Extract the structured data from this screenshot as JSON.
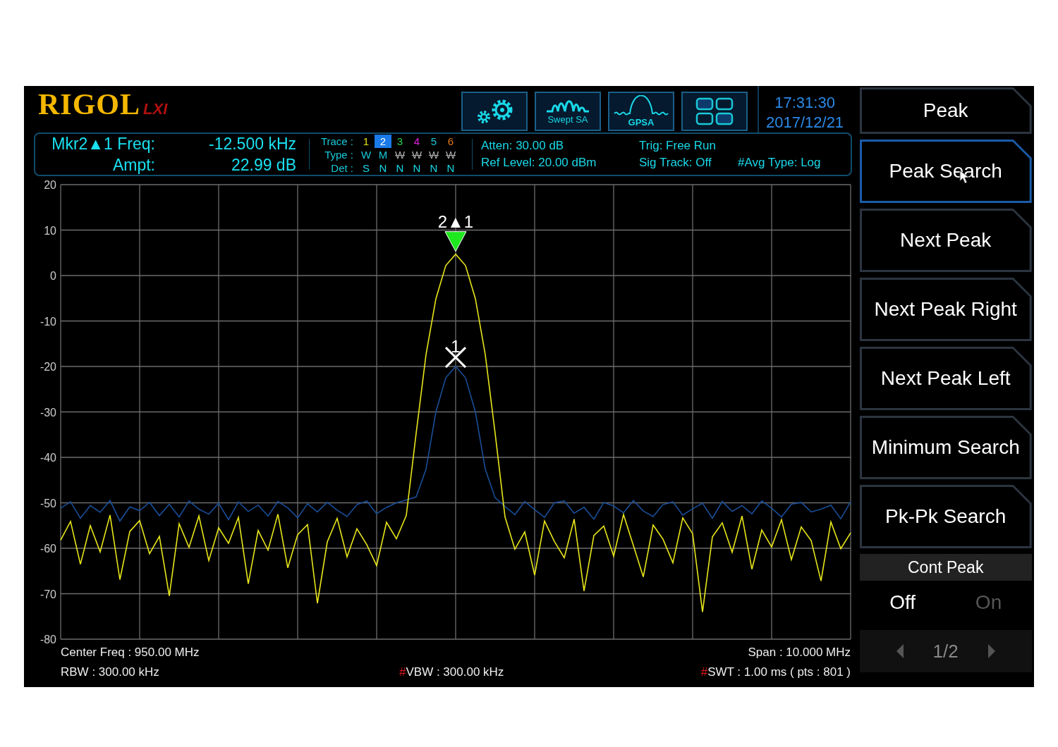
{
  "logo": {
    "brand": "RIGOL",
    "badge": "LXI"
  },
  "mode_buttons": [
    {
      "kind": "settings"
    },
    {
      "kind": "swept",
      "label": "Swept SA"
    },
    {
      "kind": "gpsa",
      "label": "GPSA"
    },
    {
      "kind": "layout"
    }
  ],
  "clock": {
    "time": "17:31:30",
    "date": "2017/12/21"
  },
  "marker_readout": [
    {
      "label": "Mkr2▲1 Freq:",
      "value": "-12.500 kHz"
    },
    {
      "label": "Ampt:",
      "value": "22.99 dB"
    }
  ],
  "trace_table": {
    "trace_label": "Trace :",
    "type_label": "Type :",
    "det_label": "Det :",
    "traces": [
      {
        "number": "1",
        "color": "#e6e01a",
        "selected": false,
        "type": "W",
        "type_blank": false,
        "det": "S"
      },
      {
        "number": "2",
        "color": "#1a7ae8",
        "selected": true,
        "type": "M",
        "type_blank": false,
        "det": "N"
      },
      {
        "number": "3",
        "color": "#2fd04a",
        "selected": false,
        "type": "W",
        "type_blank": true,
        "det": "N"
      },
      {
        "number": "4",
        "color": "#e020e0",
        "selected": false,
        "type": "W",
        "type_blank": true,
        "det": "N"
      },
      {
        "number": "5",
        "color": "#19c8d8",
        "selected": false,
        "type": "W",
        "type_blank": true,
        "det": "N"
      },
      {
        "number": "6",
        "color": "#e07a1a",
        "selected": false,
        "type": "W",
        "type_blank": true,
        "det": "N"
      }
    ]
  },
  "status": [
    [
      "Atten: 30.00 dB",
      "Trig: Free Run"
    ],
    [
      "Ref Level: 20.00 dBm",
      "Sig Track: Off",
      "#Avg Type: Log"
    ]
  ],
  "chart_data": {
    "type": "line",
    "grid": true,
    "ylim": [
      -80,
      20
    ],
    "yticks": [
      20,
      10,
      0,
      -10,
      -20,
      -30,
      -40,
      -50,
      -60,
      -70,
      -80
    ],
    "series": [
      {
        "color": "#1a4e98",
        "values": [
          -51.2,
          -49.8,
          -53.4,
          -50.6,
          -52.1,
          -49.5,
          -54.0,
          -50.9,
          -51.7,
          -49.9,
          -52.8,
          -50.3,
          -53.1,
          -49.6,
          -51.4,
          -52.5,
          -50.1,
          -53.7,
          -49.8,
          -51.9,
          -50.5,
          -52.9,
          -49.7,
          -51.1,
          -53.3,
          -50.2,
          -52.0,
          -49.9,
          -51.6,
          -53.0,
          -50.4,
          -49.6,
          -52.4,
          -51.0,
          -50.0,
          -49.4,
          -48.7,
          -42.6,
          -30.0,
          -22.5,
          -20.0,
          -22.5,
          -30.0,
          -42.6,
          -48.9,
          -50.8,
          -52.6,
          -49.7,
          -51.5,
          -53.2,
          -50.0,
          -49.6,
          -52.3,
          -51.0,
          -53.6,
          -49.9,
          -50.7,
          -52.2,
          -49.5,
          -51.8,
          -53.0,
          -50.4,
          -49.8,
          -52.7,
          -51.3,
          -50.1,
          -53.4,
          -49.7,
          -51.9,
          -50.6,
          -52.4,
          -49.6,
          -51.2,
          -53.1,
          -50.3,
          -49.9,
          -52.0,
          -51.4,
          -50.5,
          -53.5,
          -49.8
        ]
      },
      {
        "color": "#e8e61a",
        "values": [
          -58.2,
          -54.1,
          -63.5,
          -55.0,
          -60.8,
          -52.7,
          -66.9,
          -56.3,
          -53.9,
          -61.2,
          -57.4,
          -70.5,
          -54.6,
          -59.8,
          -52.9,
          -62.7,
          -55.5,
          -58.9,
          -53.2,
          -67.8,
          -56.1,
          -60.4,
          -52.5,
          -64.3,
          -57.0,
          -54.8,
          -72.1,
          -58.6,
          -53.4,
          -61.9,
          -55.7,
          -59.2,
          -63.8,
          -54.3,
          -57.9,
          -52.8,
          -34.7,
          -17.4,
          -5.1,
          2.2,
          4.7,
          2.2,
          -5.1,
          -17.4,
          -34.7,
          -53.1,
          -60.2,
          -56.4,
          -65.9,
          -54.0,
          -58.5,
          -62.1,
          -53.6,
          -69.4,
          -57.2,
          -55.1,
          -61.7,
          -52.6,
          -59.4,
          -66.3,
          -54.9,
          -58.0,
          -63.2,
          -53.3,
          -56.8,
          -74.0,
          -57.5,
          -54.4,
          -60.9,
          -52.9,
          -64.6,
          -56.0,
          -59.7,
          -53.7,
          -62.5,
          -55.3,
          -58.3,
          -67.2,
          -54.2,
          -60.1,
          -56.6
        ]
      }
    ]
  },
  "markers": [
    {
      "kind": "delta",
      "label": "2▲1"
    },
    {
      "kind": "normal",
      "label": "1"
    }
  ],
  "footer": {
    "left": [
      {
        "text": "Center Freq : 950.00 MHz"
      },
      {
        "text": "RBW : 300.00 kHz"
      }
    ],
    "center": [
      {
        "prefix": "#",
        "text": "VBW : 300.00 kHz"
      }
    ],
    "right": [
      {
        "text": "Span : 10.000 MHz"
      },
      {
        "prefix": "#",
        "text": "SWT : 1.00 ms ( pts : 801 )"
      }
    ]
  },
  "menu": [
    {
      "kind": "title",
      "label": "Peak"
    },
    {
      "kind": "button",
      "label": "Peak Search",
      "selected": true
    },
    {
      "kind": "button",
      "label": "Next Peak",
      "selected": false
    },
    {
      "kind": "button",
      "label": "Next Peak Right",
      "selected": false
    },
    {
      "kind": "button",
      "label": "Next Peak Left",
      "selected": false
    },
    {
      "kind": "button",
      "label": "Minimum Search",
      "selected": false
    },
    {
      "kind": "button",
      "label": "Pk-Pk Search",
      "selected": false
    },
    {
      "kind": "toggle",
      "label": "Cont Peak",
      "options": [
        {
          "label": "Off",
          "selected": true
        },
        {
          "label": "On",
          "selected": false
        }
      ]
    }
  ],
  "pager": {
    "text": "1/2"
  }
}
